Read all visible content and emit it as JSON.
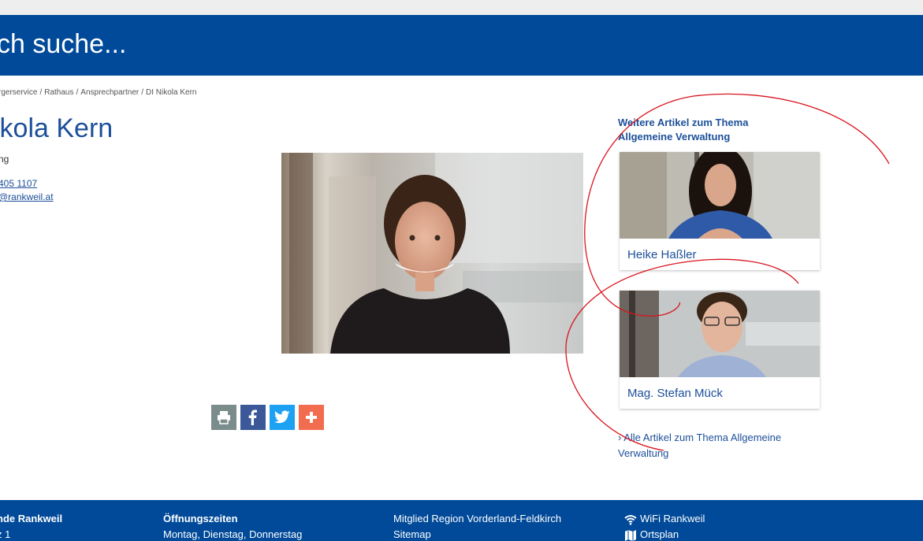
{
  "search": {
    "text": "ch suche..."
  },
  "breadcrumb": [
    "rgerservice",
    "Rathaus",
    "Ansprechpartner",
    "DI Nikola Kern"
  ],
  "profile": {
    "title": "ikola Kern",
    "role": "ng",
    "phone": "405 1107",
    "email": "@rankweil.at"
  },
  "share": {
    "print_icon": "print-icon",
    "facebook_icon": "facebook-icon",
    "twitter_icon": "twitter-icon",
    "more_icon": "plus-icon"
  },
  "aside": {
    "heading_line1": "Weitere Artikel zum Thema",
    "heading_line2": "Allgemeine Verwaltung",
    "cards": [
      {
        "name": "Heike Haßler"
      },
      {
        "name": "Mag. Stefan Mück"
      }
    ],
    "all_link": "› Alle Artikel zum Thema Allgemeine Verwaltung"
  },
  "footer": {
    "col1_title": "nde Rankweil",
    "col1_line": "z 1",
    "col2_title": "Öffnungszeiten",
    "col2_line": "Montag, Dienstag, Donnerstag",
    "col3_line1": "Mitglied Region Vorderland-Feldkirch",
    "col3_line2": "Sitemap",
    "col4_line1": "WiFi Rankweil",
    "col4_line2": "Ortsplan"
  },
  "colors": {
    "brand_blue": "#004a99",
    "link_blue": "#1c4f9a",
    "annotation_red": "#d9141e"
  }
}
